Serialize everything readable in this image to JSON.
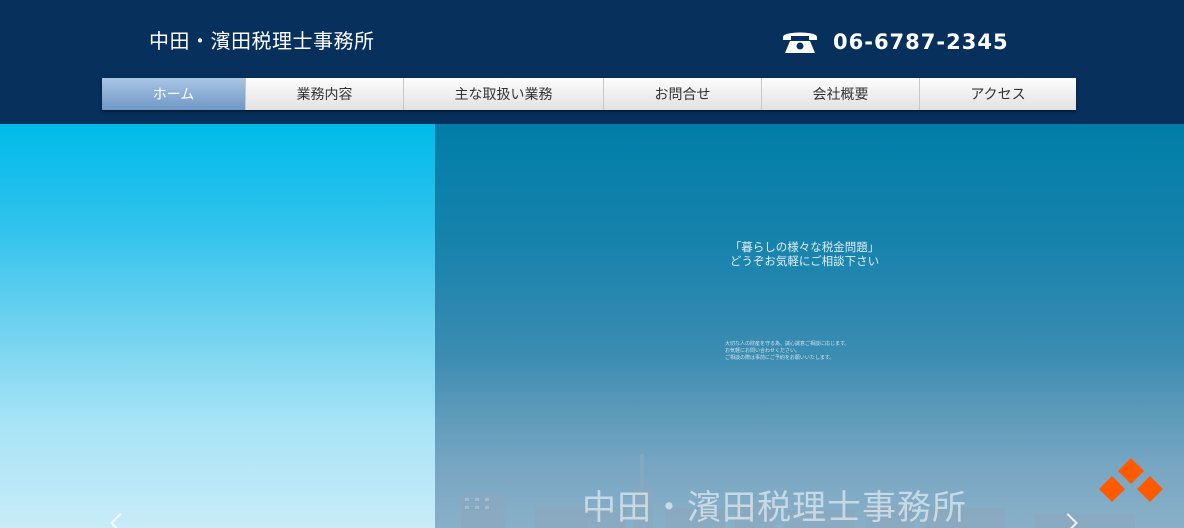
{
  "header": {
    "site_title": "中田・濱田税理士事務所",
    "phone": "06-6787-2345",
    "phone_icon": "telephone-icon"
  },
  "nav": {
    "items": [
      {
        "label": "ホーム",
        "active": true
      },
      {
        "label": "業務内容",
        "active": false
      },
      {
        "label": "主な取扱い業務",
        "active": false
      },
      {
        "label": "お問合せ",
        "active": false
      },
      {
        "label": "会社概要",
        "active": false
      },
      {
        "label": "アクセス",
        "active": false
      }
    ]
  },
  "hero": {
    "lead_line1": "「暮らしの様々な税金問題」",
    "lead_line2": "どうぞお気軽にご相談下さい",
    "small_line1": "大切な人の財産を守る為、誠心誠意ご相談に応じます。",
    "small_line2": "お気軽にお問い合わせください。",
    "small_line3": "ご相談の際は事前にご予約をお願いいたします。",
    "title": "中田・濱田税理士事務所"
  },
  "colors": {
    "header_bg": "#07305c",
    "nav_active": "#7fa4cf",
    "logo_orange": "#ff5a00"
  }
}
